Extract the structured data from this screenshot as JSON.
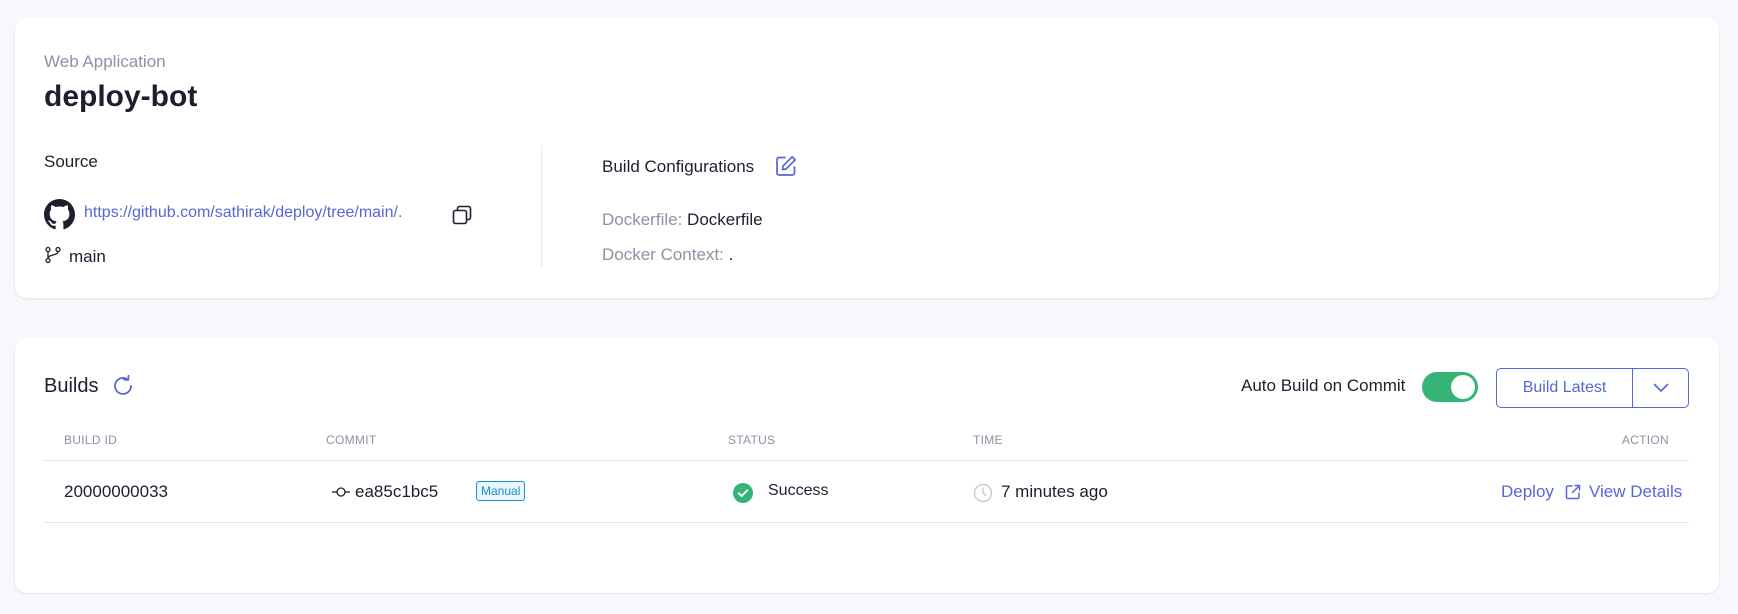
{
  "app": {
    "type_label": "Web Application",
    "name": "deploy-bot"
  },
  "source": {
    "heading": "Source",
    "repo_url": "https://github.com/sathirak/deploy/tree/main/.",
    "branch": "main"
  },
  "build_config": {
    "heading": "Build Configurations",
    "dockerfile_label": "Dockerfile:",
    "dockerfile_value": "Dockerfile",
    "context_label": "Docker Context:",
    "context_value": "."
  },
  "builds": {
    "heading": "Builds",
    "auto_build_label": "Auto Build on Commit",
    "auto_build_enabled": true,
    "build_latest_label": "Build Latest",
    "columns": {
      "build_id": "BUILD ID",
      "commit": "COMMIT",
      "status": "STATUS",
      "time": "TIME",
      "action": "ACTION"
    },
    "rows": [
      {
        "build_id": "20000000033",
        "commit": "ea85c1bc5",
        "trigger": "Manual",
        "status": "Success",
        "time": "7 minutes ago",
        "deploy_label": "Deploy",
        "details_label": "View Details"
      }
    ]
  },
  "colors": {
    "accent": "#5567d5",
    "success": "#36b475",
    "badge": "#1b8fd0",
    "muted_text": "#8d91a3"
  },
  "icons": {
    "repo": "github-icon",
    "copy": "copy-icon",
    "branch": "git-branch-icon",
    "edit": "edit-icon",
    "refresh": "refresh-icon",
    "dropdown": "chevron-down-icon",
    "commit": "git-commit-icon",
    "status": "check-circle-icon",
    "time": "clock-icon",
    "external": "external-link-icon"
  }
}
